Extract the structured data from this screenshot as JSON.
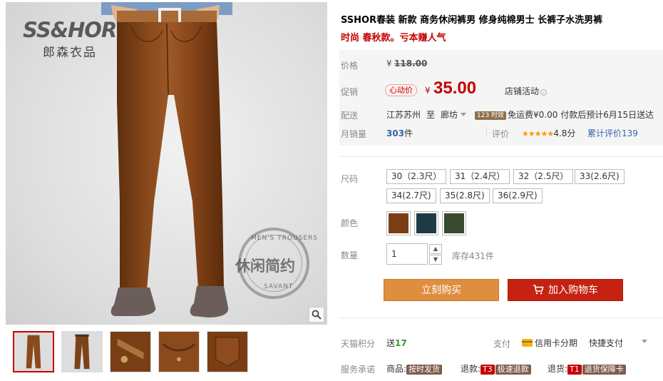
{
  "gallery": {
    "brand_logo": "SS&HOR",
    "brand_sub": "郎森衣品",
    "stamp_text": "休闲简约",
    "stamp_top": "MEN'S TROUSERS",
    "stamp_bottom": "SAVANT",
    "thumbnails": [
      "thumb-1",
      "thumb-2",
      "thumb-3",
      "thumb-4",
      "thumb-5"
    ]
  },
  "product": {
    "title": "SSHOR春装 新款 商务休闲裤男 修身纯棉男士 长裤子水洗男裤",
    "subtitle": "时尚 春秋款。亏本赚人气"
  },
  "price": {
    "price_label": "价格",
    "currency": "¥",
    "original": "118.00",
    "promo_label": "促销",
    "promo_tag": "心动价",
    "promo_price": "35.00",
    "shop_promo": "店铺活动",
    "ship_label": "配送",
    "ship_from": "江苏苏州",
    "ship_to_word": "至",
    "ship_to": "廊坊",
    "time_badge": "123 时效",
    "freight": "免运费¥0.00 付款后预计6月15日送达",
    "sales_label": "月销量",
    "sales_count": "303",
    "sales_unit": "件",
    "rating_label": "评价",
    "stars": "★★★★★",
    "rating_value": "4.8分",
    "total_reviews": "累计评价139"
  },
  "sku": {
    "size_label": "尺码",
    "sizes": [
      "30（2.3尺）",
      "31（2.4尺）",
      "32（2.5尺）",
      "33(2.6尺)",
      "34(2.7尺)",
      "35(2.8尺)",
      "36(2.9尺)"
    ],
    "color_label": "颜色",
    "colors": [
      "#7a3e14",
      "#213b45",
      "#3a4a2e"
    ],
    "qty_label": "数量",
    "qty_value": "1",
    "qty_up": "▲",
    "qty_down": "▼",
    "stock": "库存431件"
  },
  "actions": {
    "buy_now": "立刻购买",
    "add_to_cart": "加入购物车",
    "cart_icon": "cart-icon"
  },
  "services": {
    "points_label": "天猫积分",
    "points_send": "送",
    "points_value": "17",
    "pay_label": "支付",
    "credit": "信用卡分期",
    "quick_pay": "快捷支付",
    "promise_label": "服务承诺",
    "goods_label": "商品:",
    "goods_badge": "按时发货",
    "refund_label": "退款:",
    "refund_t3": "T3",
    "refund_badge": "极速退款",
    "return_label": "退货:",
    "return_t1": "T1",
    "return_badge": "退货保障卡"
  }
}
